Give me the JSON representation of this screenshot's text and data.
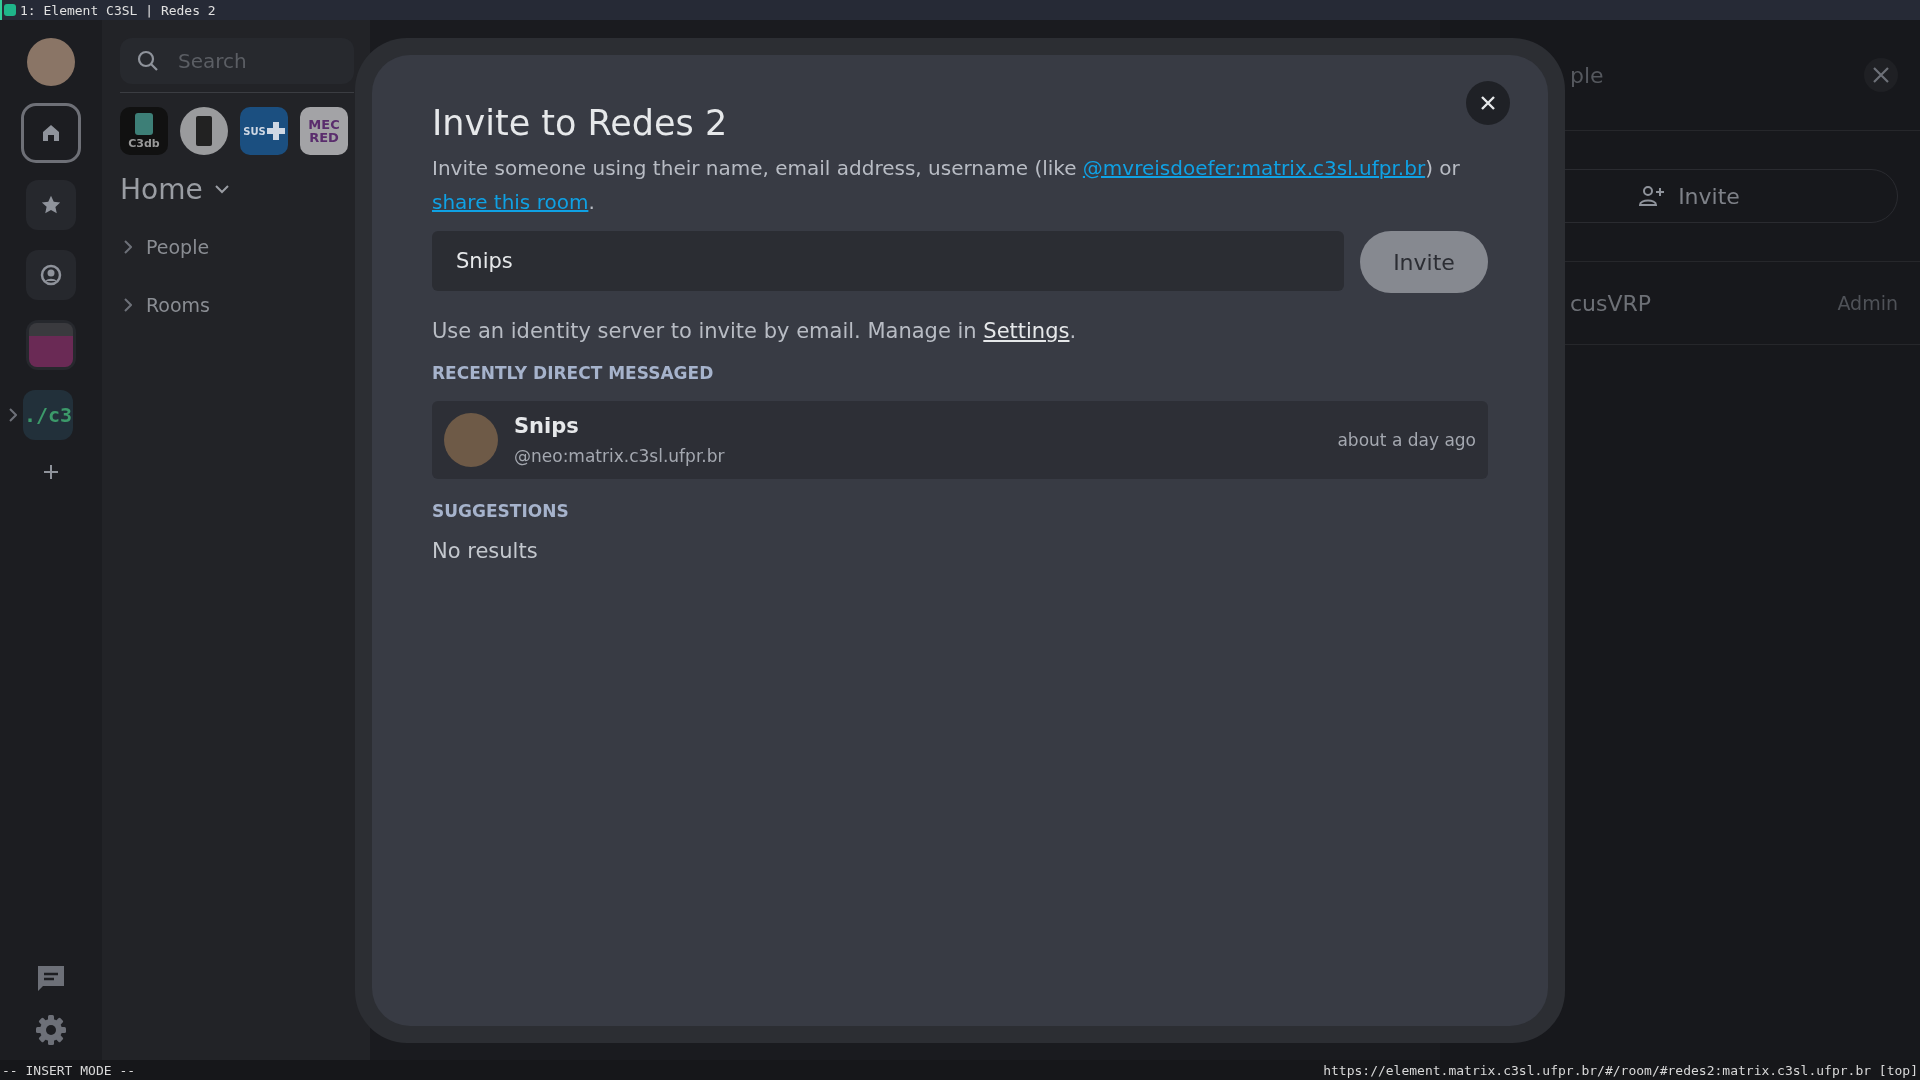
{
  "window": {
    "title": "1: Element C3SL | Redes 2"
  },
  "rail": [
    {
      "kind": "avatar"
    },
    {
      "kind": "home",
      "selected": true
    },
    {
      "kind": "favourites",
      "selected": false
    },
    {
      "kind": "people",
      "selected": false
    },
    {
      "kind": "space",
      "selected": false
    },
    {
      "kind": "text",
      "label": "./c3",
      "selected": false
    },
    {
      "kind": "add"
    }
  ],
  "room_list": {
    "search": {
      "placeholder": "Search"
    },
    "spaces": [
      {
        "kind": "c3db",
        "label": "C3db"
      },
      {
        "kind": "server"
      },
      {
        "kind": "sus",
        "label": "SUS"
      },
      {
        "kind": "mecred",
        "label": "MEC RED"
      }
    ],
    "heading": "Home",
    "sections": [
      {
        "label": "People",
        "expanded": false
      },
      {
        "label": "Rooms",
        "expanded": false
      }
    ]
  },
  "right_panel": {
    "title": "ple",
    "invite_button": "Invite",
    "members": [
      {
        "name": "cusVRP",
        "role": "Admin"
      }
    ]
  },
  "dialog": {
    "title": "Invite to Redes 2",
    "description": {
      "text": "Invite someone using their name, email address, username (like ",
      "link": "@mvreisdoefer:matrix.c3sl.ufpr.br",
      "middle": ") or ",
      "link2": "share this room",
      "end": "."
    },
    "input": {
      "value": "Snips"
    },
    "invite_button": "Invite",
    "identity": {
      "text": "Use an identity server to invite by email. Manage in ",
      "link": "Settings",
      "end": "."
    },
    "sections": [
      {
        "title": "RECENTLY DIRECT MESSAGED",
        "results": [
          {
            "name": "Snips",
            "user_id": "@neo:matrix.c3sl.ufpr.br",
            "time": "about a day ago"
          }
        ]
      },
      {
        "title": "SUGGESTIONS",
        "empty": "No results"
      }
    ]
  },
  "status_bar": {
    "mode": "-- INSERT MODE --",
    "url": "https://element.matrix.c3sl.ufpr.br/#/room/#redes2:matrix.c3sl.ufpr.br [top]"
  }
}
